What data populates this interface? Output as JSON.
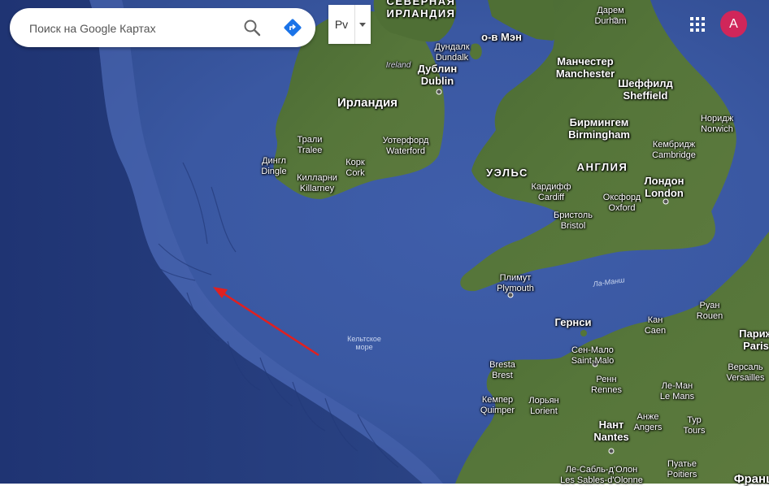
{
  "search": {
    "placeholder": "Поиск на Google Картах"
  },
  "layer_selector": {
    "label": "Рv"
  },
  "account": {
    "initial": "A",
    "color": "#d0265a"
  },
  "icons": {
    "search": "search-icon",
    "directions": "directions-icon",
    "apps": "apps-grid-icon",
    "caret": "caret-down-icon"
  },
  "annotation": {
    "arrow_color": "#e02020"
  },
  "map_labels": {
    "north_ireland": "СЕВЕРНАЯ\nИРЛАНДИЯ",
    "isle_of_man": "о-в Мэн",
    "durham": "Дарем\nDurham",
    "dundalk": "Дундалк\nDundalk",
    "ireland_italic": "Ireland",
    "dublin": "Дублин\nDublin",
    "manchester": "Манчестер\nManchester",
    "sheffield": "Шеффилд\nSheffield",
    "ireland": "Ирландия",
    "birmingham": "Бирмингем\nBirmingham",
    "norwich": "Норидж\nNorwich",
    "tralee": "Трали\nTralee",
    "waterford": "Уотерфорд\nWaterford",
    "cambridge": "Кембридж\nCambridge",
    "dingle": "Дингл\nDingle",
    "cork": "Корк\nCork",
    "wales": "УЭЛЬС",
    "england": "АНГЛИЯ",
    "killarney": "Килларни\nKillarney",
    "cardiff": "Кардифф\nCardiff",
    "oxford": "Оксфорд\nOxford",
    "london": "Лондон\nLondon",
    "bristol": "Бристоль\nBristol",
    "plymouth": "Плимут\nPlymouth",
    "la_manche": "Ла-Манш",
    "rouen": "Руан\nRouen",
    "guernsey": "Гернси",
    "caen": "Кан\nCaen",
    "celtic_sea": "Кельтское\nморе",
    "paris": "Париж\nParis",
    "saint_malo": "Сен-Мало\nSaint-Malo",
    "versailles": "Версаль\nVersailles",
    "brest": "Bresta\nBrest",
    "rennes": "Ренн\nRennes",
    "le_mans": "Ле-Ман\nLe Mans",
    "quimper": "Кемпер\nQuimper",
    "lorient": "Лорьян\nLorient",
    "angers": "Анже\nAngers",
    "tours": "Тур\nTours",
    "nantes": "Нант\nNantes",
    "poitiers": "Пуатье\nPoitiers",
    "les_sables": "Ле-Сабль-д'Олон\nLes Sables-d'Olonne",
    "france": "Франц"
  }
}
